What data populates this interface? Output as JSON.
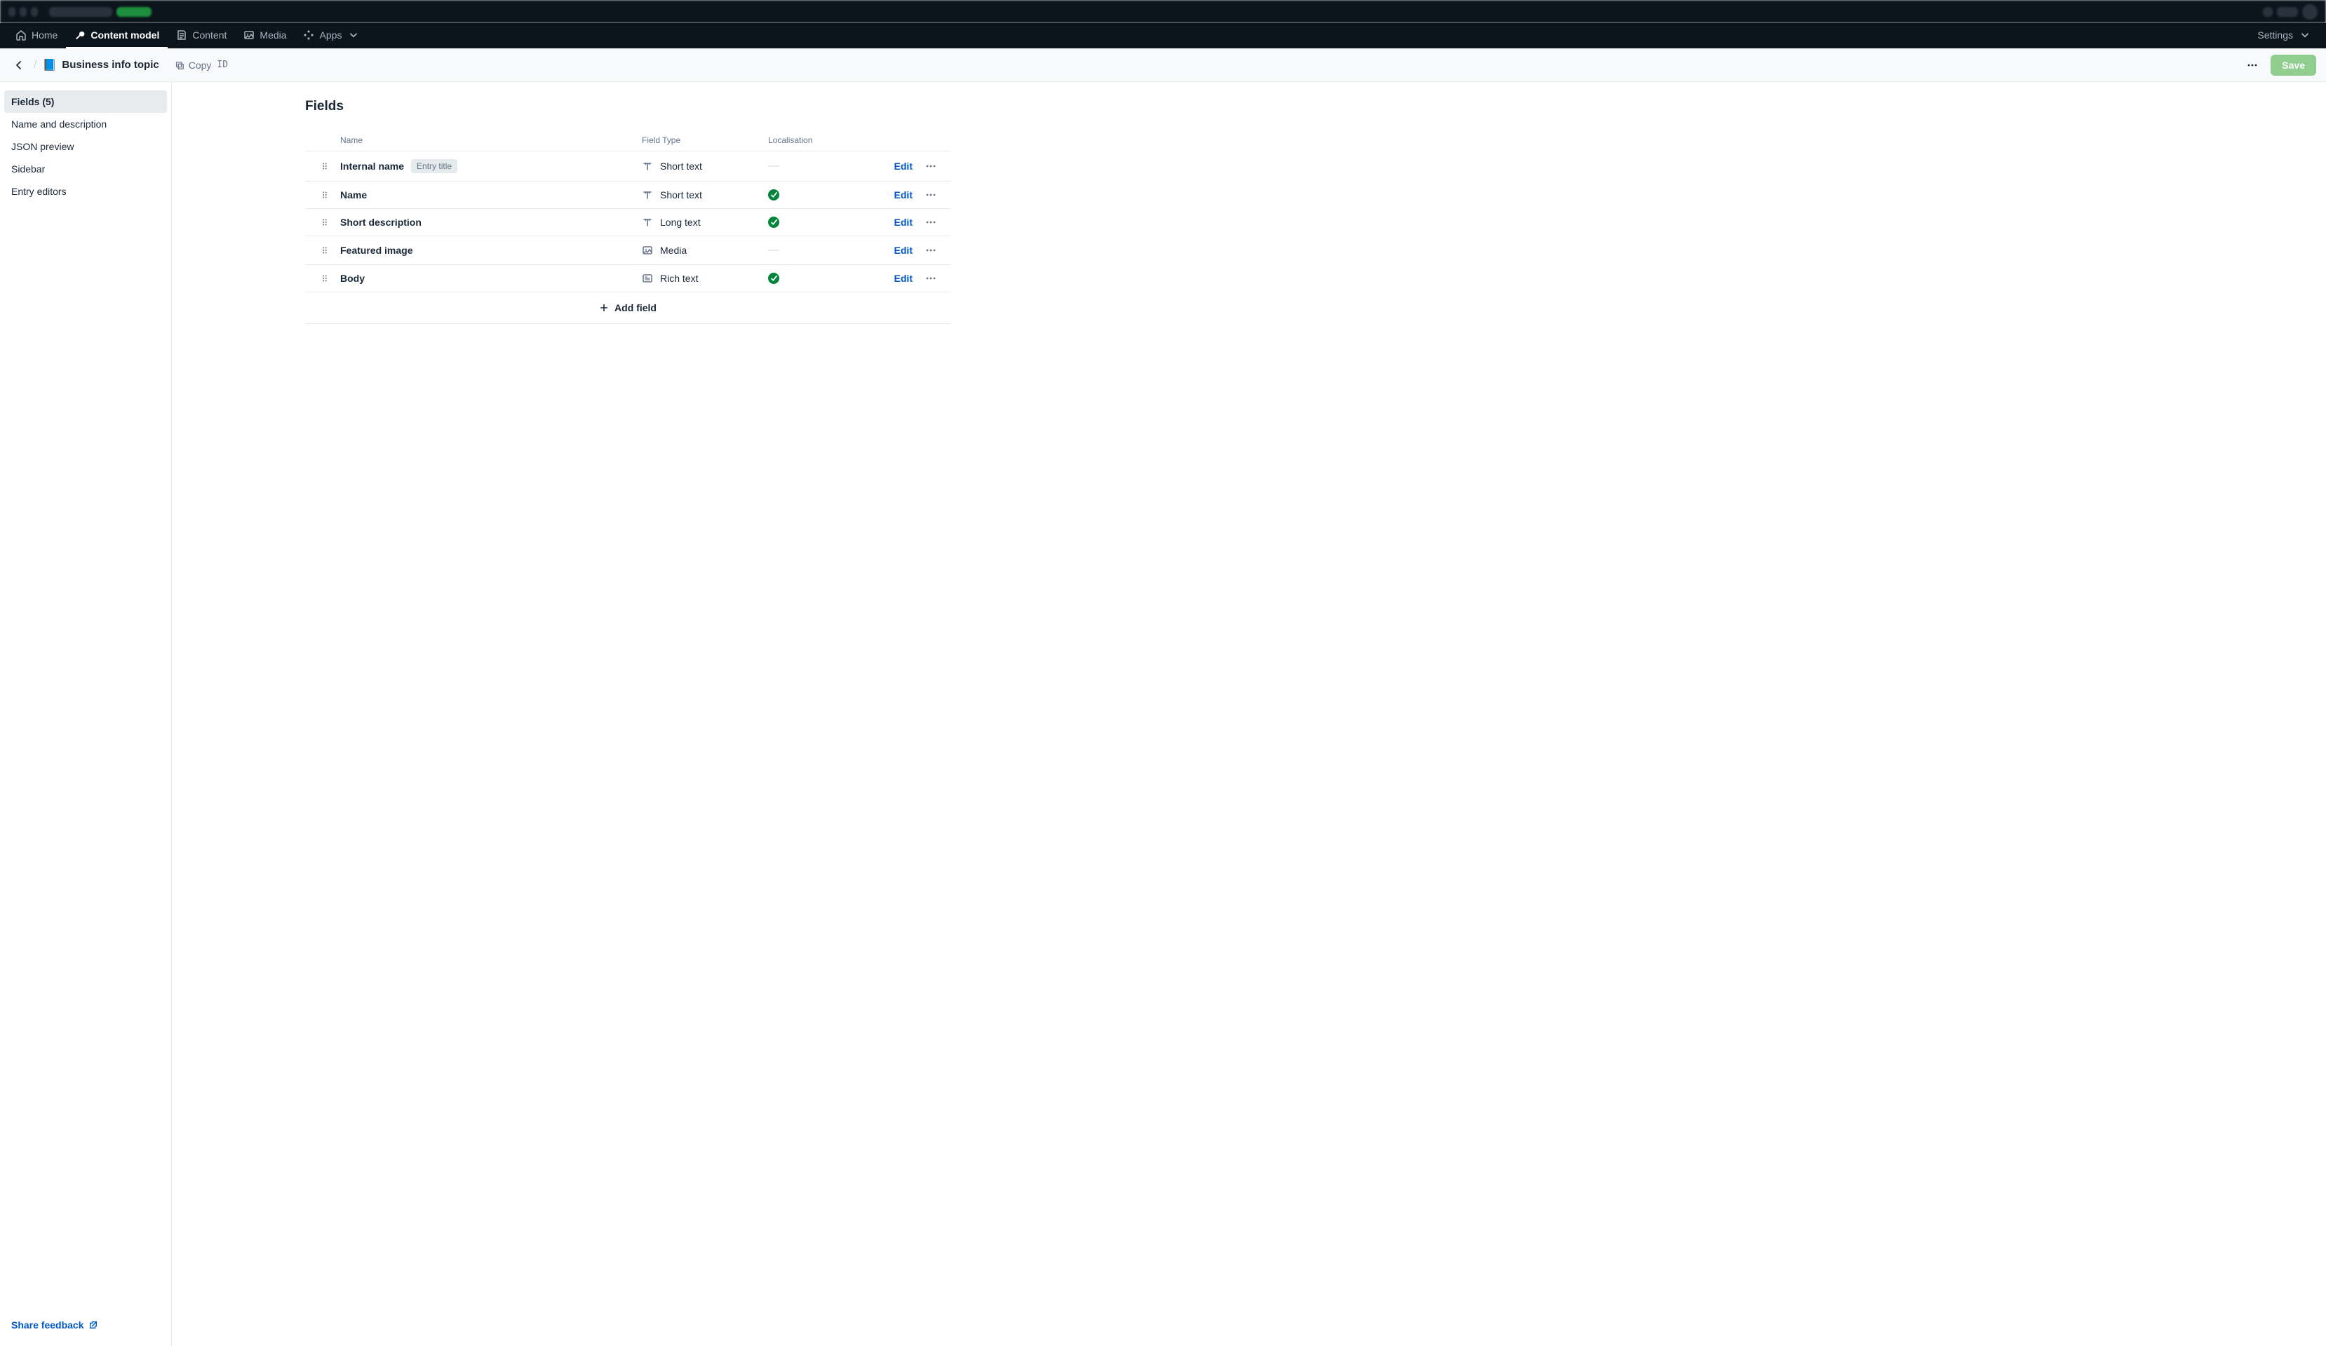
{
  "nav": {
    "items": [
      {
        "label": "Home",
        "icon": "home-icon",
        "active": false
      },
      {
        "label": "Content model",
        "icon": "wrench-icon",
        "active": true
      },
      {
        "label": "Content",
        "icon": "content-icon",
        "active": false
      },
      {
        "label": "Media",
        "icon": "media-icon",
        "active": false
      },
      {
        "label": "Apps",
        "icon": "apps-icon",
        "active": false,
        "has_caret": true
      }
    ],
    "right": {
      "settings_label": "Settings"
    }
  },
  "page_header": {
    "emoji": "📘",
    "title": "Business info topic",
    "copy_label": "Copy",
    "copy_code": "ID",
    "save_label": "Save"
  },
  "sidebar": {
    "items": [
      {
        "label": "Fields (5)",
        "active": true
      },
      {
        "label": "Name and description",
        "active": false
      },
      {
        "label": "JSON preview",
        "active": false
      },
      {
        "label": "Sidebar",
        "active": false
      },
      {
        "label": "Entry editors",
        "active": false
      }
    ],
    "feedback_label": "Share feedback"
  },
  "main": {
    "title": "Fields",
    "columns": {
      "name": "Name",
      "type": "Field Type",
      "localisation": "Localisation"
    },
    "edit_label": "Edit",
    "add_field_label": "Add field",
    "entry_title_badge": "Entry title",
    "fields": [
      {
        "name": "Internal name",
        "type_label": "Short text",
        "type_icon": "text-icon",
        "localised": false,
        "is_entry_title": true
      },
      {
        "name": "Name",
        "type_label": "Short text",
        "type_icon": "text-icon",
        "localised": true,
        "is_entry_title": false
      },
      {
        "name": "Short description",
        "type_label": "Long text",
        "type_icon": "text-icon",
        "localised": true,
        "is_entry_title": false
      },
      {
        "name": "Featured image",
        "type_label": "Media",
        "type_icon": "media-ft-icon",
        "localised": false,
        "is_entry_title": false
      },
      {
        "name": "Body",
        "type_label": "Rich text",
        "type_icon": "richtext-icon",
        "localised": true,
        "is_entry_title": false
      }
    ]
  }
}
